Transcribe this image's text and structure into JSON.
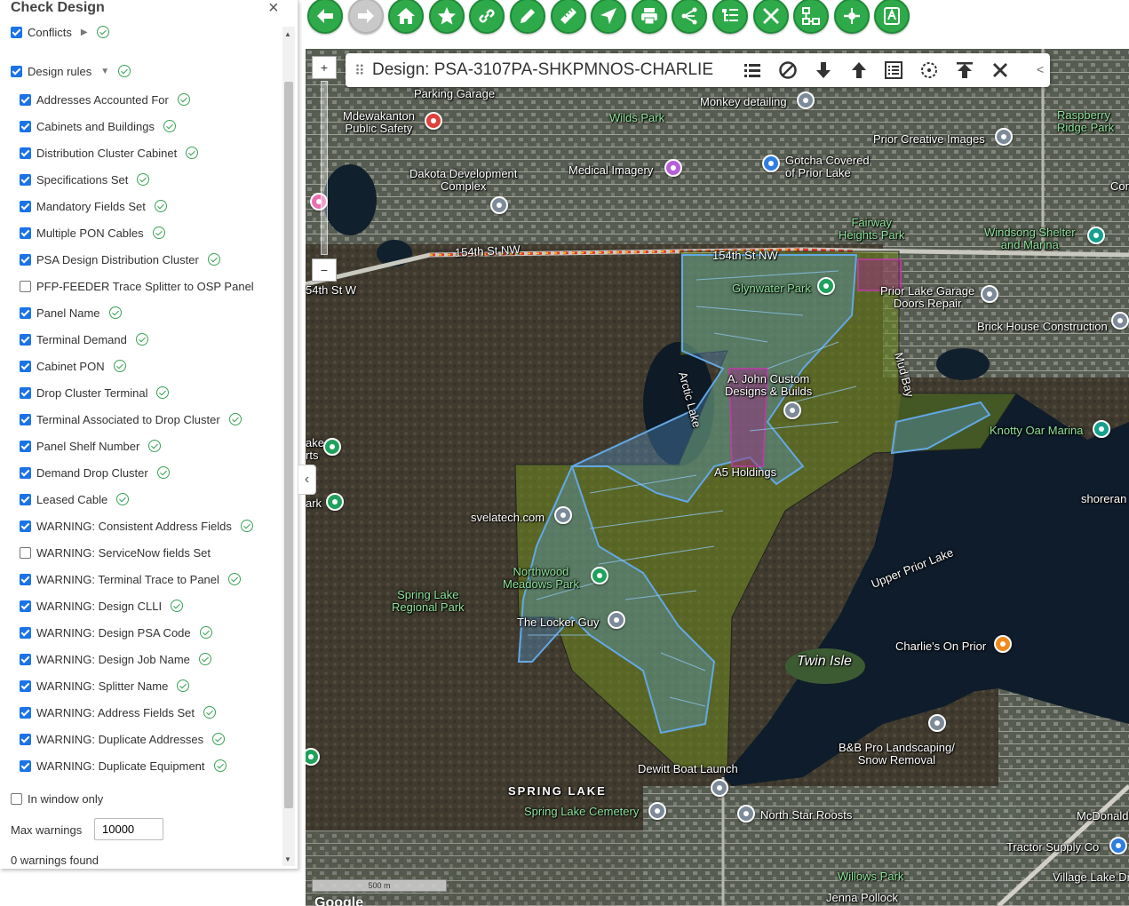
{
  "panel": {
    "title": "Check Design",
    "close_glyph": "×",
    "conflicts": {
      "label": "Conflicts",
      "checked": true
    },
    "design_rules": {
      "label": "Design rules",
      "checked": true
    },
    "rules": [
      {
        "label": "Addresses Accounted For",
        "checked": true
      },
      {
        "label": "Cabinets and Buildings",
        "checked": true
      },
      {
        "label": "Distribution Cluster Cabinet",
        "checked": true
      },
      {
        "label": "Specifications Set",
        "checked": true
      },
      {
        "label": "Mandatory Fields Set",
        "checked": true
      },
      {
        "label": "Multiple PON Cables",
        "checked": true
      },
      {
        "label": "PSA Design Distribution Cluster",
        "checked": true
      },
      {
        "label": "PFP-FEEDER Trace Splitter to OSP Panel",
        "checked": false
      },
      {
        "label": "Panel Name",
        "checked": true
      },
      {
        "label": "Terminal Demand",
        "checked": true
      },
      {
        "label": "Cabinet PON",
        "checked": true
      },
      {
        "label": "Drop Cluster Terminal",
        "checked": true
      },
      {
        "label": "Terminal Associated to Drop Cluster",
        "checked": true
      },
      {
        "label": "Panel Shelf Number",
        "checked": true
      },
      {
        "label": "Demand Drop Cluster",
        "checked": true
      },
      {
        "label": "Leased Cable",
        "checked": true
      },
      {
        "label": "WARNING: Consistent Address Fields",
        "checked": true
      },
      {
        "label": "WARNING: ServiceNow fields Set",
        "checked": false
      },
      {
        "label": "WARNING: Terminal Trace to Panel",
        "checked": true
      },
      {
        "label": "WARNING: Design CLLI",
        "checked": true
      },
      {
        "label": "WARNING: Design PSA Code",
        "checked": true
      },
      {
        "label": "WARNING: Design Job Name",
        "checked": true
      },
      {
        "label": "WARNING: Splitter Name",
        "checked": true
      },
      {
        "label": "WARNING: Address Fields Set",
        "checked": true
      },
      {
        "label": "WARNING: Duplicate Addresses",
        "checked": true
      },
      {
        "label": "WARNING: Duplicate Equipment",
        "checked": true
      }
    ],
    "in_window_only": {
      "label": "In window only",
      "checked": false
    },
    "max_warnings": {
      "label": "Max warnings",
      "value": "10000"
    },
    "status": "0 warnings found"
  },
  "toolbar": {
    "buttons": [
      {
        "icon": "back-arrow-icon",
        "enabled": true
      },
      {
        "icon": "forward-arrow-icon",
        "enabled": false
      },
      {
        "icon": "home-icon",
        "enabled": true
      },
      {
        "icon": "star-icon",
        "enabled": true
      },
      {
        "icon": "link-icon",
        "enabled": true
      },
      {
        "icon": "pencil-icon",
        "enabled": true
      },
      {
        "icon": "ruler-icon",
        "enabled": true
      },
      {
        "icon": "navigate-icon",
        "enabled": true
      },
      {
        "icon": "print-icon",
        "enabled": true
      },
      {
        "icon": "share-icon",
        "enabled": true
      },
      {
        "icon": "list-tree-icon",
        "enabled": true
      },
      {
        "icon": "tools-icon",
        "enabled": true
      },
      {
        "icon": "network-icon",
        "enabled": true
      },
      {
        "icon": "connect-icon",
        "enabled": true
      },
      {
        "icon": "text-check-icon",
        "enabled": true
      }
    ],
    "colors": {
      "active": "#2faa4a",
      "disabled": "#c9c9c9"
    }
  },
  "design_bar": {
    "title": "Design: PSA-3107PA-SHKPMNOS-CHARLIE",
    "icons": [
      "list-icon",
      "cancel-icon",
      "arrow-down-icon",
      "arrow-up-icon",
      "details-icon",
      "target-icon",
      "upload-icon",
      "close-icon"
    ],
    "collapse_glyph": "<"
  },
  "map": {
    "labels": [
      {
        "text": "Parking Garage",
        "style": ""
      },
      {
        "text": "Mdewakanton\nPublic Safety",
        "style": ""
      },
      {
        "text": "Wilds Park",
        "style": "green"
      },
      {
        "text": "Monkey detailing",
        "style": ""
      },
      {
        "text": "Raspberry\nRidge Park",
        "style": "green"
      },
      {
        "text": "Prior Creative Images",
        "style": ""
      },
      {
        "text": "Medical Imagery",
        "style": ""
      },
      {
        "text": "Gotcha Covered\nof Prior Lake",
        "style": ""
      },
      {
        "text": "Dakota Development\nComplex",
        "style": ""
      },
      {
        "text": "Fairway\nHeights Park",
        "style": "green"
      },
      {
        "text": "Windsong Shelter\nand Marina",
        "style": "green"
      },
      {
        "text": "154th St NW",
        "style": ""
      },
      {
        "text": "154th St NW",
        "style": ""
      },
      {
        "text": "54th St W",
        "style": ""
      },
      {
        "text": "Glynwater Park",
        "style": "green"
      },
      {
        "text": "Prior Lake Garage\nDoors Repair",
        "style": ""
      },
      {
        "text": "Brick House Construction",
        "style": ""
      },
      {
        "text": "Arctic Lake",
        "style": ""
      },
      {
        "text": "A. John Custom\nDesigns & Builds",
        "style": ""
      },
      {
        "text": "Mud Bay",
        "style": ""
      },
      {
        "text": "Knotty Oar Marina",
        "style": "green"
      },
      {
        "text": "A5 Holdings",
        "style": ""
      },
      {
        "text": "shoreran",
        "style": ""
      },
      {
        "text": "svelatech.com",
        "style": ""
      },
      {
        "text": "Northwood\nMeadows Park",
        "style": "green"
      },
      {
        "text": "Upper Prior Lake",
        "style": ""
      },
      {
        "text": "Spring Lake\nRegional Park",
        "style": "green"
      },
      {
        "text": "The Locker Guy",
        "style": ""
      },
      {
        "text": "Charlie's On Prior",
        "style": ""
      },
      {
        "text": "Twin Isle",
        "style": "big"
      },
      {
        "text": "B&B Pro Landscaping/\nSnow Removal",
        "style": ""
      },
      {
        "text": "Dewitt Boat Launch",
        "style": ""
      },
      {
        "text": "SPRING LAKE",
        "style": "caps"
      },
      {
        "text": "Spring Lake Cemetery",
        "style": "green"
      },
      {
        "text": "North Star Roosts",
        "style": ""
      },
      {
        "text": "McDonald's",
        "style": ""
      },
      {
        "text": "Tractor Supply Co",
        "style": ""
      },
      {
        "text": "Willows Park",
        "style": "green"
      },
      {
        "text": "Village Lake Dr",
        "style": ""
      },
      {
        "text": "Jenna Pollock",
        "style": ""
      },
      {
        "text": "ake\nrts",
        "style": ""
      },
      {
        "text": "ark",
        "style": ""
      },
      {
        "text": "Comm",
        "style": ""
      }
    ],
    "scale_label": "500 m",
    "attribution": "Google",
    "zoom_in": "+",
    "zoom_out": "−"
  }
}
